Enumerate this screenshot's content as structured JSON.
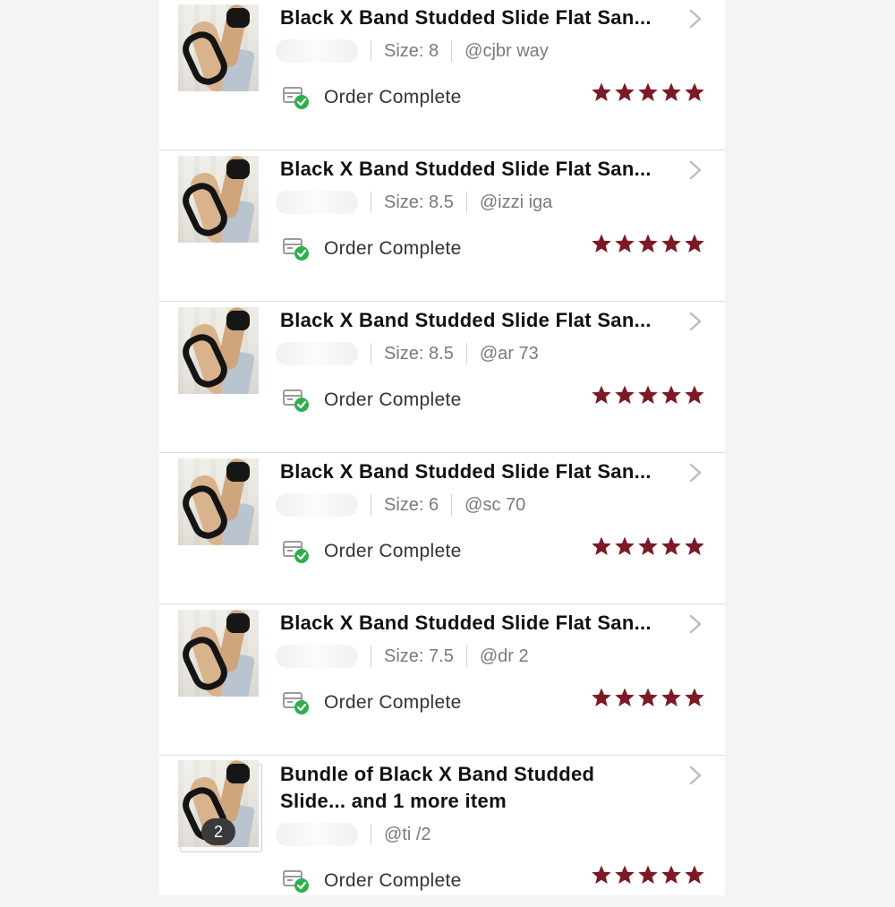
{
  "colors": {
    "star": "#7b1a26",
    "check": "#2fae4e"
  },
  "orders": [
    {
      "title": "Black X Band Studded Slide Flat San...",
      "size": "Size: 8",
      "username": "@cjbr    way",
      "status": "Order Complete",
      "rating": 5
    },
    {
      "title": "Black X Band Studded Slide Flat San...",
      "size": "Size: 8.5",
      "username": "@izzi      iga",
      "status": "Order Complete",
      "rating": 5
    },
    {
      "title": "Black X Band Studded Slide Flat San...",
      "size": "Size: 8.5",
      "username": "@ar      73",
      "status": "Order Complete",
      "rating": 5
    },
    {
      "title": "Black X Band Studded Slide Flat San...",
      "size": "Size: 6",
      "username": "@sc     70",
      "status": "Order Complete",
      "rating": 5
    },
    {
      "title": "Black X Band Studded Slide Flat San...",
      "size": "Size: 7.5",
      "username": "@dr    2",
      "status": "Order Complete",
      "rating": 5
    },
    {
      "title": "Bundle of Black X Band Studded Slide... and 1 more item",
      "size": "",
      "username": "@ti     /2",
      "status": "Order Complete",
      "rating": 5,
      "item_count": "2"
    }
  ]
}
